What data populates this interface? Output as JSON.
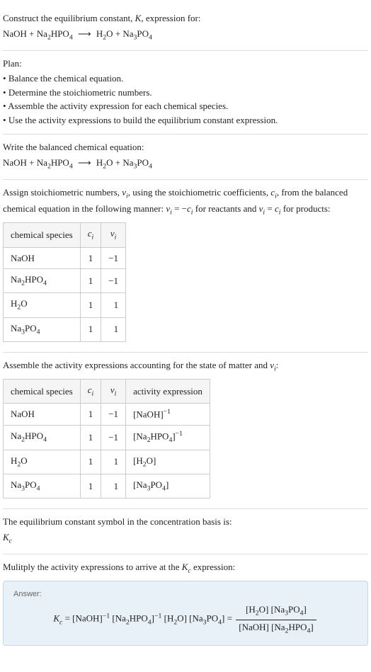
{
  "intro": {
    "line1": "Construct the equilibrium constant, ",
    "kvar": "K",
    "line1b": ", expression for:",
    "equation_lhs1": "NaOH + Na",
    "equation_lhs2": "HPO",
    "equation_rhs1": "H",
    "equation_rhs2": "O + Na",
    "equation_rhs3": "PO",
    "arrow": "⟶"
  },
  "plan": {
    "title": "Plan:",
    "items": [
      "Balance the chemical equation.",
      "Determine the stoichiometric numbers.",
      "Assemble the activity expression for each chemical species.",
      "Use the activity expressions to build the equilibrium constant expression."
    ]
  },
  "balanced": {
    "title": "Write the balanced chemical equation:"
  },
  "stoich": {
    "text1": "Assign stoichiometric numbers, ",
    "nu": "ν",
    "text2": ", using the stoichiometric coefficients, ",
    "ci": "c",
    "text3": ", from the balanced chemical equation in the following manner: ",
    "rel1a": "ν",
    "rel1b": " = −",
    "rel1c": "c",
    "text4": " for reactants and ",
    "rel2a": "ν",
    "rel2b": " = ",
    "rel2c": "c",
    "text5": " for products:",
    "headers": [
      "chemical species",
      "c",
      "ν"
    ],
    "rows": [
      {
        "species": "NaOH",
        "c": "1",
        "nu": "−1"
      },
      {
        "species_pre": "Na",
        "species_sub1": "2",
        "species_mid": "HPO",
        "species_sub2": "4",
        "c": "1",
        "nu": "−1"
      },
      {
        "species_pre": "H",
        "species_sub1": "2",
        "species_mid": "O",
        "c": "1",
        "nu": "1"
      },
      {
        "species_pre": "Na",
        "species_sub1": "3",
        "species_mid": "PO",
        "species_sub2": "4",
        "c": "1",
        "nu": "1"
      }
    ]
  },
  "activity": {
    "text1": "Assemble the activity expressions accounting for the state of matter and ",
    "nu": "ν",
    "text2": ":",
    "headers": [
      "chemical species",
      "c",
      "ν",
      "activity expression"
    ],
    "rows": [
      {
        "species": "NaOH",
        "c": "1",
        "nu": "−1",
        "act": "[NaOH]",
        "exp": "−1"
      },
      {
        "species_pre": "Na",
        "species_sub1": "2",
        "species_mid": "HPO",
        "species_sub2": "4",
        "c": "1",
        "nu": "−1",
        "act_pre": "[Na",
        "act_mid": "HPO",
        "act_suf": "]",
        "exp": "−1"
      },
      {
        "species_pre": "H",
        "species_sub1": "2",
        "species_mid": "O",
        "c": "1",
        "nu": "1",
        "act_pre": "[H",
        "act_mid": "O]",
        "act_sub": "2"
      },
      {
        "species_pre": "Na",
        "species_sub1": "3",
        "species_mid": "PO",
        "species_sub2": "4",
        "c": "1",
        "nu": "1",
        "act_pre": "[Na",
        "act_mid": "PO",
        "act_suf": "]"
      }
    ]
  },
  "symbol": {
    "text": "The equilibrium constant symbol in the concentration basis is:",
    "kc_k": "K",
    "kc_c": "c"
  },
  "multiply": {
    "text1": "Mulitply the activity expressions to arrive at the ",
    "kc_k": "K",
    "kc_c": "c",
    "text2": " expression:"
  },
  "answer": {
    "label": "Answer:",
    "eq": " = ",
    "exp_neg1": "−1",
    "kc_k": "K",
    "kc_c": "c"
  },
  "sub": {
    "i": "i",
    "two": "2",
    "three": "3",
    "four": "4"
  }
}
